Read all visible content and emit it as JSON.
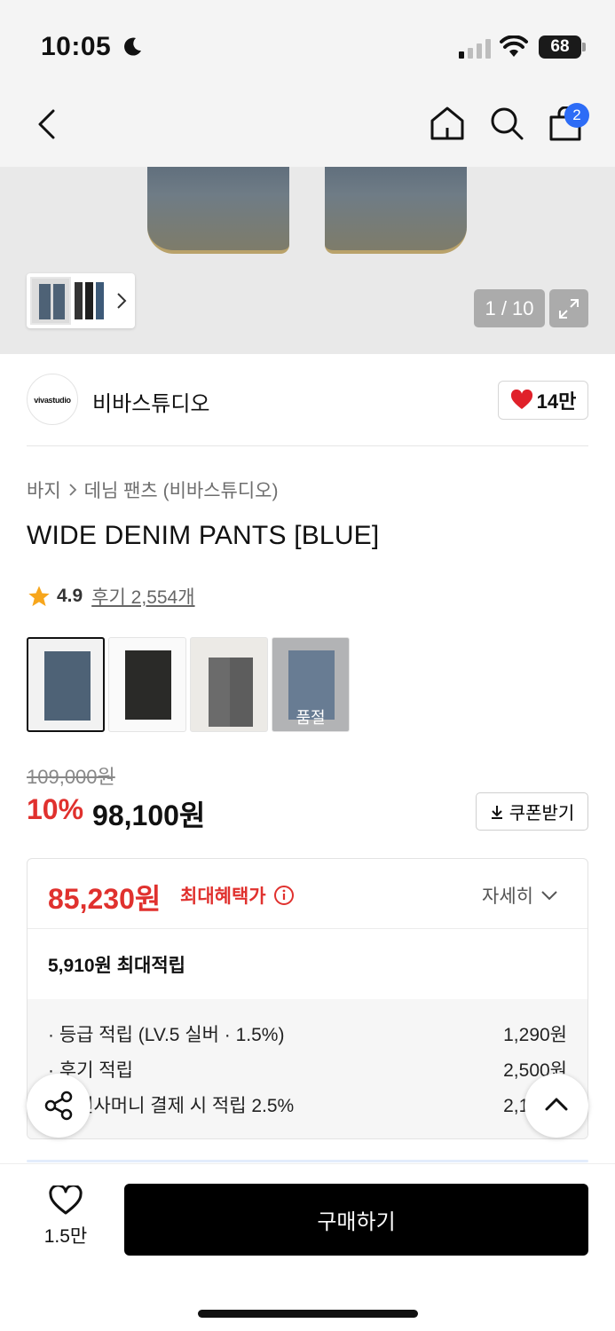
{
  "status": {
    "time": "10:05",
    "battery": "68"
  },
  "nav": {
    "cart_count": "2"
  },
  "gallery": {
    "pager": "1 / 10"
  },
  "brand": {
    "logo_text": "vivastudio",
    "name": "비바스튜디오",
    "likes": "14만"
  },
  "breadcrumb": {
    "category": "바지",
    "subcategory": "데님 팬츠 (비바스튜디오)"
  },
  "product": {
    "title": "WIDE DENIM PANTS [BLUE]",
    "rating": "4.9",
    "reviews": "후기 2,554개",
    "sold_out_label": "품절",
    "colors": [
      {
        "name": "blue",
        "color": "#4e6276"
      },
      {
        "name": "black",
        "color": "#2a2a28"
      },
      {
        "name": "grey",
        "color": "#6b6b6b"
      },
      {
        "name": "light-blue",
        "color": "#7f98b4"
      }
    ]
  },
  "price": {
    "original": "109,000원",
    "discount": "10%",
    "sale": "98,100원",
    "coupon_label": "쿠폰받기"
  },
  "benefit": {
    "max_price": "85,230원",
    "max_label": "최대혜택가",
    "detail_label": "자세히",
    "max_point": "5,910원 최대적립",
    "items": [
      {
        "label": "· 등급 적립 (LV.5 실버 · 1.5%)",
        "value": "1,290원"
      },
      {
        "label": "· 후기 적립",
        "value": "2,500원"
      },
      {
        "label": "· 무신사머니 결제 시 적립 2.5%",
        "value": "2,120원"
      }
    ]
  },
  "bottom": {
    "wish_count": "1.5만",
    "buy_label": "구매하기"
  },
  "colors": {
    "accent_red": "#e0312e",
    "badge_blue": "#2d6cf6"
  }
}
